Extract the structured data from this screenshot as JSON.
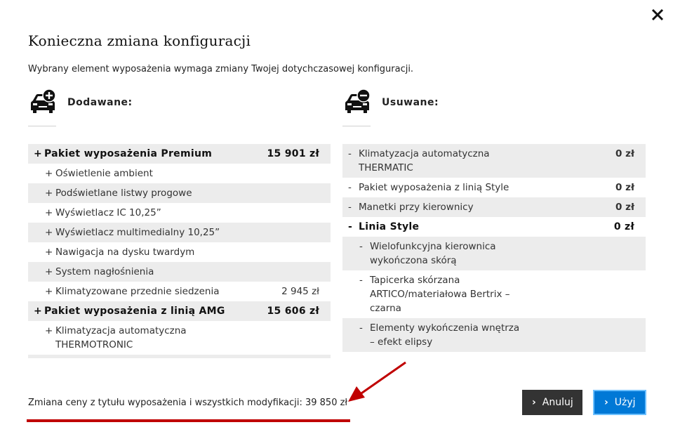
{
  "dialog": {
    "title": "Konieczna zmiana konfiguracji",
    "subtitle": "Wybrany element wyposażenia wymaga zmiany Twojej dotychczasowej konfiguracji."
  },
  "added": {
    "heading": "Dodawane:",
    "icon": "car-plus-icon",
    "rows": [
      {
        "sign": "+",
        "name": "Pakiet wyposażenia Premium",
        "price": "15 901 zł"
      },
      {
        "sign": "+",
        "name": "Oświetlenie ambient",
        "price": ""
      },
      {
        "sign": "+",
        "name": "Podświetlane listwy progowe",
        "price": ""
      },
      {
        "sign": "+",
        "name": "Wyświetlacz IC 10,25”",
        "price": ""
      },
      {
        "sign": "+",
        "name": "Wyświetlacz multimedialny 10,25”",
        "price": ""
      },
      {
        "sign": "+",
        "name": "Nawigacja na dysku twardym",
        "price": ""
      },
      {
        "sign": "+",
        "name": "System nagłośnienia",
        "price": ""
      },
      {
        "sign": "+",
        "name": "Klimatyzowane przednie siedzenia",
        "price": "2 945 zł"
      },
      {
        "sign": "+",
        "name": "Pakiet wyposażenia z linią AMG",
        "price": "15 606 zł"
      },
      {
        "sign": "+",
        "name": "Klimatyzacja automatyczna THERMOTRONIC",
        "price": ""
      }
    ]
  },
  "removed": {
    "heading": "Usuwane:",
    "icon": "car-minus-icon",
    "rows": [
      {
        "sign": "-",
        "name": "Klimatyzacja automatyczna THERMATIC",
        "price": "0 zł"
      },
      {
        "sign": "-",
        "name": "Pakiet wyposażenia z linią Style",
        "price": "0 zł"
      },
      {
        "sign": "-",
        "name": "Manetki przy kierownicy",
        "price": "0 zł"
      },
      {
        "sign": "-",
        "name": "Linia Style",
        "price": "0 zł"
      },
      {
        "sign": "-",
        "name": "Wielofunkcyjna kierownica wykończona skórą",
        "price": ""
      },
      {
        "sign": "-",
        "name": "Tapicerka skórzana ARTICO/materiałowa Bertrix – czarna",
        "price": ""
      },
      {
        "sign": "-",
        "name": "Elementy wykończenia wnętrza – efekt elipsy",
        "price": ""
      }
    ]
  },
  "footer": {
    "price_change": "Zmiana ceny z tytułu wyposażenia i wszystkich modyfikacji: 39 850 zł"
  },
  "buttons": {
    "cancel": "Anuluj",
    "apply": "Użyj"
  },
  "colors": {
    "accent": "#0078d6",
    "cancel_bg": "#333333",
    "row_shade": "#ececec",
    "annotation": "#c00000"
  }
}
